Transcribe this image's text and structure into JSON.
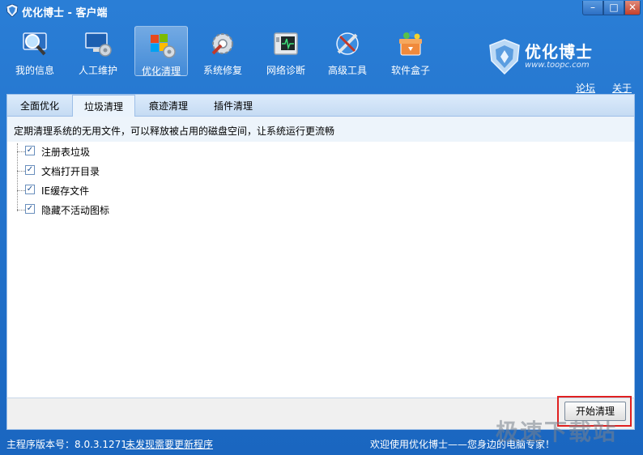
{
  "window": {
    "title": "优化博士 - 客户端"
  },
  "toolbar": {
    "items": [
      {
        "label": "我的信息"
      },
      {
        "label": "人工维护"
      },
      {
        "label": "优化清理"
      },
      {
        "label": "系统修复"
      },
      {
        "label": "网络诊断"
      },
      {
        "label": "高级工具"
      },
      {
        "label": "软件盒子"
      }
    ]
  },
  "brand": {
    "name": "优化博士",
    "url": "www.toopc.com"
  },
  "links": {
    "forum": "论坛",
    "about": "关于"
  },
  "tabs": [
    {
      "label": "全面优化"
    },
    {
      "label": "垃圾清理"
    },
    {
      "label": "痕迹清理"
    },
    {
      "label": "插件清理"
    }
  ],
  "content": {
    "description": "定期清理系统的无用文件，可以释放被占用的磁盘空间，让系统运行更流畅",
    "items": [
      {
        "label": "注册表垃圾"
      },
      {
        "label": "文档打开目录"
      },
      {
        "label": "IE缓存文件"
      },
      {
        "label": "隐藏不活动图标"
      }
    ],
    "check_mark": "✓"
  },
  "actions": {
    "start_label": "开始清理"
  },
  "status": {
    "version": "主程序版本号：8.0.3.1271",
    "update_link": "未发现需要更新程序",
    "welcome": "欢迎使用优化博士——您身边的电脑专家！"
  },
  "watermark": "极速下载站",
  "colors": {
    "frame": "#1a66c0",
    "tab_bg": "#c5dbf3",
    "highlight": "#e02020"
  }
}
